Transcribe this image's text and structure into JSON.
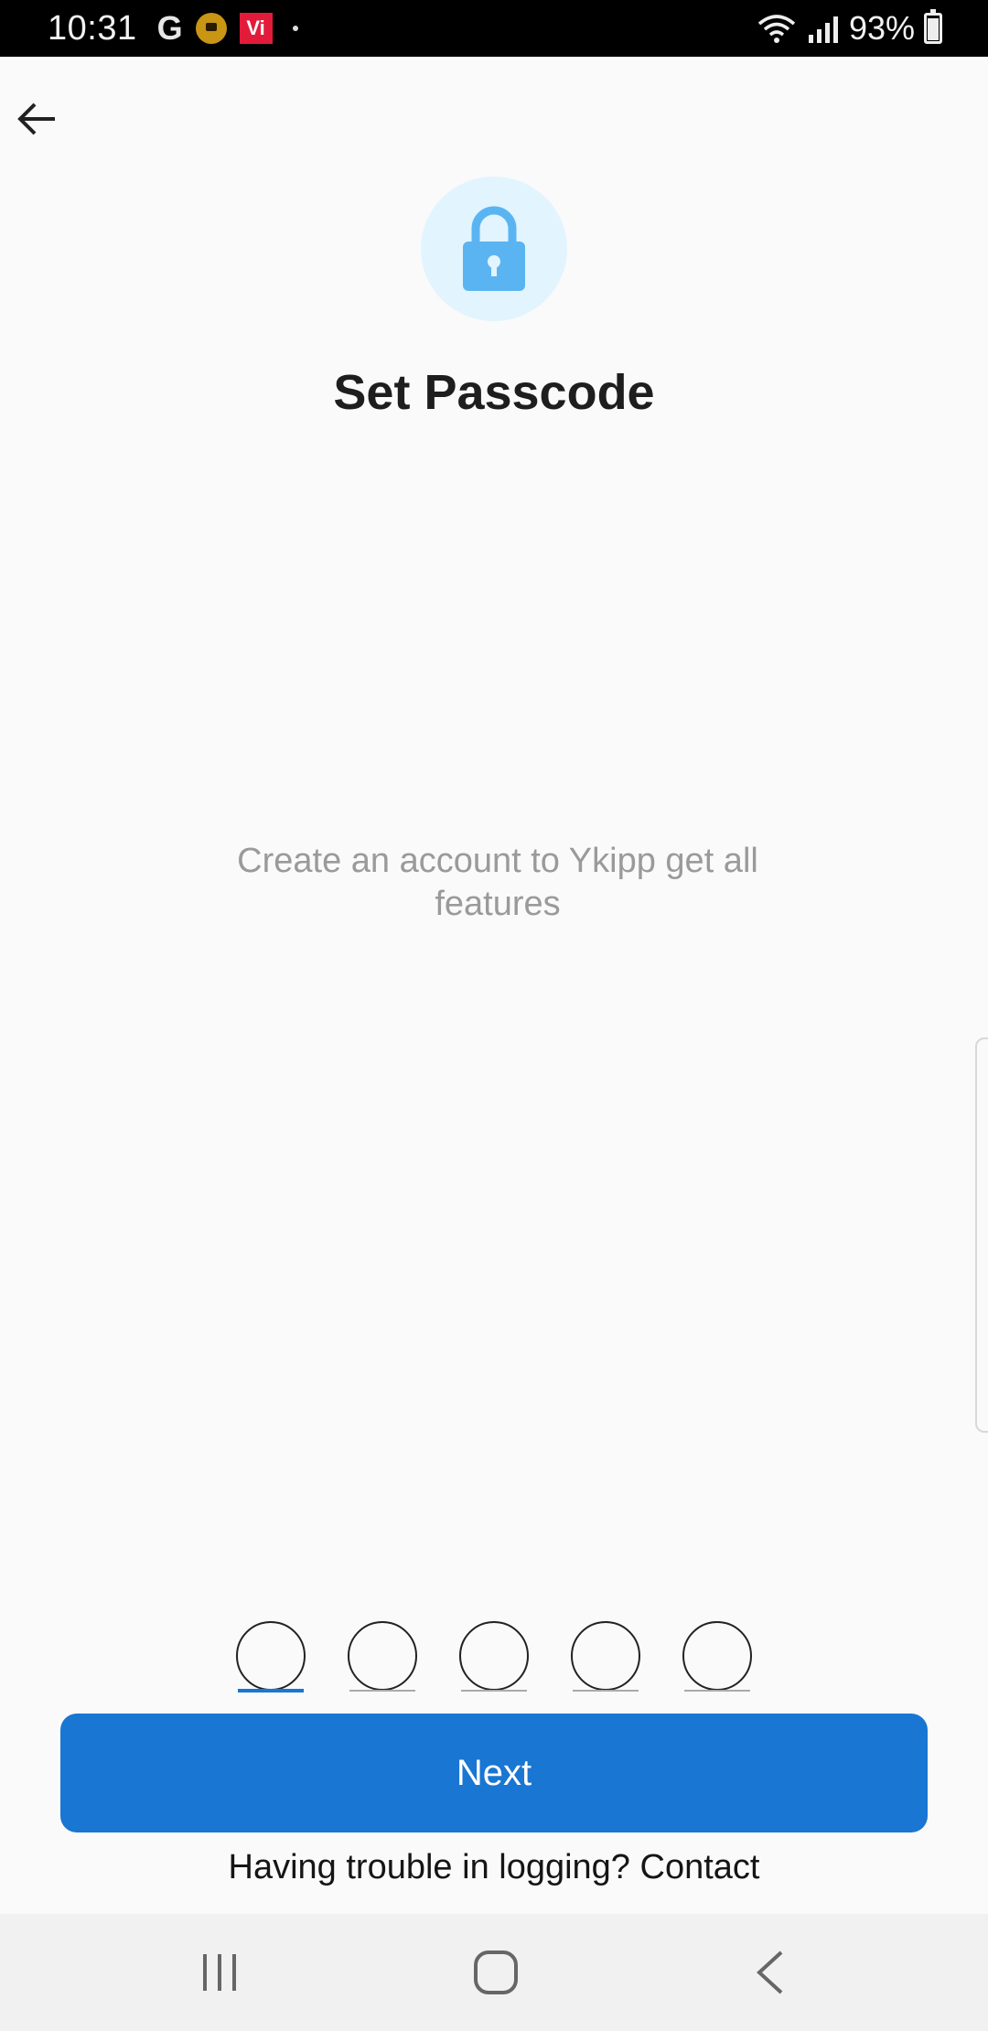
{
  "status_bar": {
    "time": "10:31",
    "battery": "93%",
    "vi_badge": "Vi"
  },
  "header": {
    "back_icon": "arrow-left-icon"
  },
  "lock_icon": "lock-icon",
  "title": "Set Passcode",
  "subtitle": "Create an account to Ykipp get all features",
  "passcode": {
    "length": 5,
    "active_index": 0
  },
  "next_label": "Next",
  "help_text": "Having trouble in logging? Contact",
  "nav": {
    "recents_icon": "recents-icon",
    "home_icon": "home-icon",
    "back_icon": "back-chevron-icon"
  },
  "colors": {
    "accent": "#1976d2",
    "lock_bg": "#e2f4fe",
    "lock_fg": "#5bb4f2"
  }
}
